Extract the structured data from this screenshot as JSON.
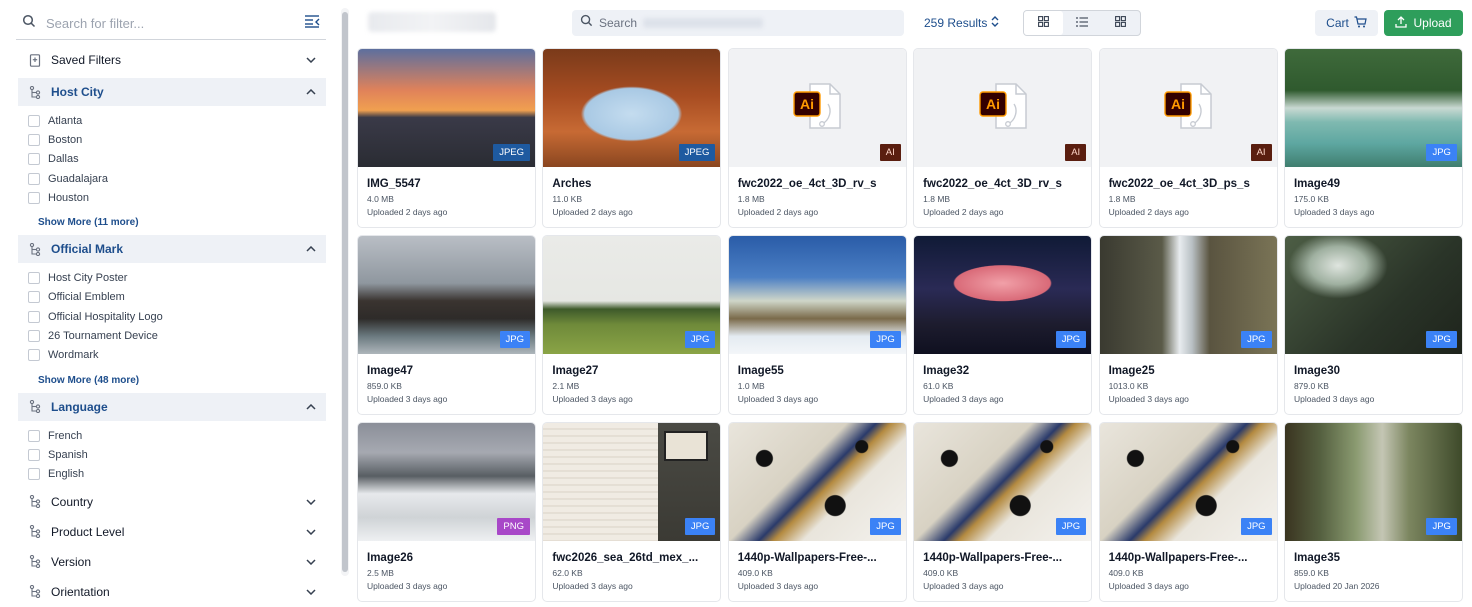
{
  "sidebar": {
    "search_placeholder": "Search for filter...",
    "saved_filters": "Saved Filters",
    "host_city": {
      "label": "Host City",
      "options": [
        "Atlanta",
        "Boston",
        "Dallas",
        "Guadalajara",
        "Houston"
      ],
      "show_more": "Show More (11 more)"
    },
    "official_mark": {
      "label": "Official Mark",
      "options": [
        "Host City Poster",
        "Official Emblem",
        "Official Hospitality Logo",
        "26 Tournament Device",
        "Wordmark"
      ],
      "show_more": "Show More (48 more)"
    },
    "language": {
      "label": "Language",
      "options": [
        "French",
        "Spanish",
        "English"
      ]
    },
    "collapsed": [
      "Country",
      "Product Level",
      "Version",
      "Orientation"
    ]
  },
  "toolbar": {
    "search_placeholder": "Search",
    "results": "259 Results",
    "cart": "Cart",
    "upload": "Upload"
  },
  "assets": [
    {
      "name": "IMG_5547",
      "size": "4.0 MB",
      "uploaded": "Uploaded 2 days ago",
      "type": "JPEG",
      "scene": "sunset"
    },
    {
      "name": "Arches",
      "size": "11.0 KB",
      "uploaded": "Uploaded 2 days ago",
      "type": "JPEG",
      "scene": "arch"
    },
    {
      "name": "fwc2022_oe_4ct_3D_rv_s",
      "size": "1.8 MB",
      "uploaded": "Uploaded 2 days ago",
      "type": "AI",
      "scene": "ai"
    },
    {
      "name": "fwc2022_oe_4ct_3D_rv_s",
      "size": "1.8 MB",
      "uploaded": "Uploaded 2 days ago",
      "type": "AI",
      "scene": "ai"
    },
    {
      "name": "fwc2022_oe_4ct_3D_ps_s",
      "size": "1.8 MB",
      "uploaded": "Uploaded 2 days ago",
      "type": "AI",
      "scene": "ai"
    },
    {
      "name": "Image49",
      "size": "175.0 KB",
      "uploaded": "Uploaded 3 days ago",
      "type": "JPG",
      "scene": "waterfall1"
    },
    {
      "name": "Image47",
      "size": "859.0 KB",
      "uploaded": "Uploaded 3 days ago",
      "type": "JPG",
      "scene": "rock"
    },
    {
      "name": "Image27",
      "size": "2.1 MB",
      "uploaded": "Uploaded 3 days ago",
      "type": "JPG",
      "scene": "meadow"
    },
    {
      "name": "Image55",
      "size": "1.0 MB",
      "uploaded": "Uploaded 3 days ago",
      "type": "JPG",
      "scene": "icefall"
    },
    {
      "name": "Image32",
      "size": "61.0 KB",
      "uploaded": "Uploaded 3 days ago",
      "type": "JPG",
      "scene": "cloud"
    },
    {
      "name": "Image25",
      "size": "1013.0 KB",
      "uploaded": "Uploaded 3 days ago",
      "type": "JPG",
      "scene": "cliff"
    },
    {
      "name": "Image30",
      "size": "879.0 KB",
      "uploaded": "Uploaded 3 days ago",
      "type": "JPG",
      "scene": "forestfog"
    },
    {
      "name": "Image26",
      "size": "2.5 MB",
      "uploaded": "Uploaded 3 days ago",
      "type": "PNG",
      "scene": "snowmtn"
    },
    {
      "name": "fwc2026_sea_26td_mex_...",
      "size": "62.0 KB",
      "uploaded": "Uploaded 3 days ago",
      "type": "JPG",
      "scene": "blinds"
    },
    {
      "name": "1440p-Wallpapers-Free-...",
      "size": "409.0 KB",
      "uploaded": "Uploaded 3 days ago",
      "type": "JPG",
      "scene": "wall"
    },
    {
      "name": "1440p-Wallpapers-Free-...",
      "size": "409.0 KB",
      "uploaded": "Uploaded 3 days ago",
      "type": "JPG",
      "scene": "wall"
    },
    {
      "name": "1440p-Wallpapers-Free-...",
      "size": "409.0 KB",
      "uploaded": "Uploaded 3 days ago",
      "type": "JPG",
      "scene": "wall"
    },
    {
      "name": "Image35",
      "size": "859.0 KB",
      "uploaded": "Uploaded 20 Jan 2026",
      "type": "JPG",
      "scene": "trees"
    }
  ],
  "colors": {
    "accent": "#1e4e8c",
    "upload_green": "#2e9e5b",
    "jpeg_badge": "#1e5aa0",
    "jpg_badge": "#3b82f6",
    "png_badge": "#a848c8",
    "ai_badge": "#5a1e0f"
  }
}
